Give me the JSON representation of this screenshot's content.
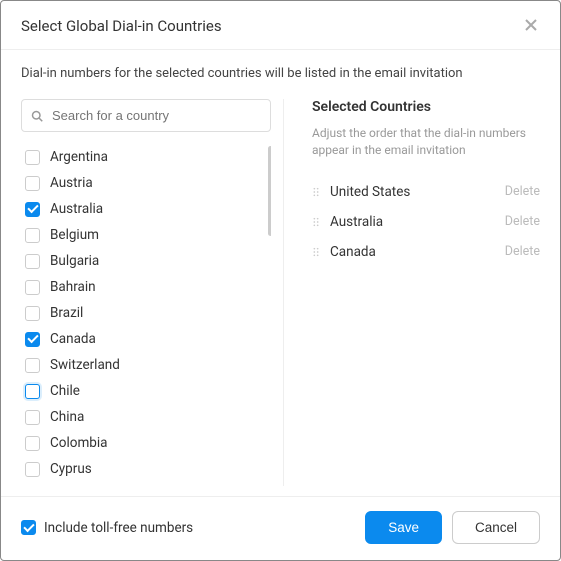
{
  "modal": {
    "title": "Select Global Dial-in Countries",
    "subtitle": "Dial-in numbers for the selected countries will be listed in the email invitation",
    "search_placeholder": "Search for a country",
    "countries": [
      {
        "name": "Argentina",
        "checked": false,
        "focused": false
      },
      {
        "name": "Austria",
        "checked": false,
        "focused": false
      },
      {
        "name": "Australia",
        "checked": true,
        "focused": false
      },
      {
        "name": "Belgium",
        "checked": false,
        "focused": false
      },
      {
        "name": "Bulgaria",
        "checked": false,
        "focused": false
      },
      {
        "name": "Bahrain",
        "checked": false,
        "focused": false
      },
      {
        "name": "Brazil",
        "checked": false,
        "focused": false
      },
      {
        "name": "Canada",
        "checked": true,
        "focused": false
      },
      {
        "name": "Switzerland",
        "checked": false,
        "focused": false
      },
      {
        "name": "Chile",
        "checked": false,
        "focused": true
      },
      {
        "name": "China",
        "checked": false,
        "focused": false
      },
      {
        "name": "Colombia",
        "checked": false,
        "focused": false
      },
      {
        "name": "Cyprus",
        "checked": false,
        "focused": false
      }
    ],
    "selected_header": "Selected Countries",
    "selected_sub": "Adjust the order that the dial-in numbers appear in the email invitation",
    "selected": [
      {
        "name": "United States"
      },
      {
        "name": "Australia"
      },
      {
        "name": "Canada"
      }
    ],
    "delete_label": "Delete",
    "toll_free_label": "Include toll-free numbers",
    "toll_free_checked": true,
    "save_label": "Save",
    "cancel_label": "Cancel"
  }
}
